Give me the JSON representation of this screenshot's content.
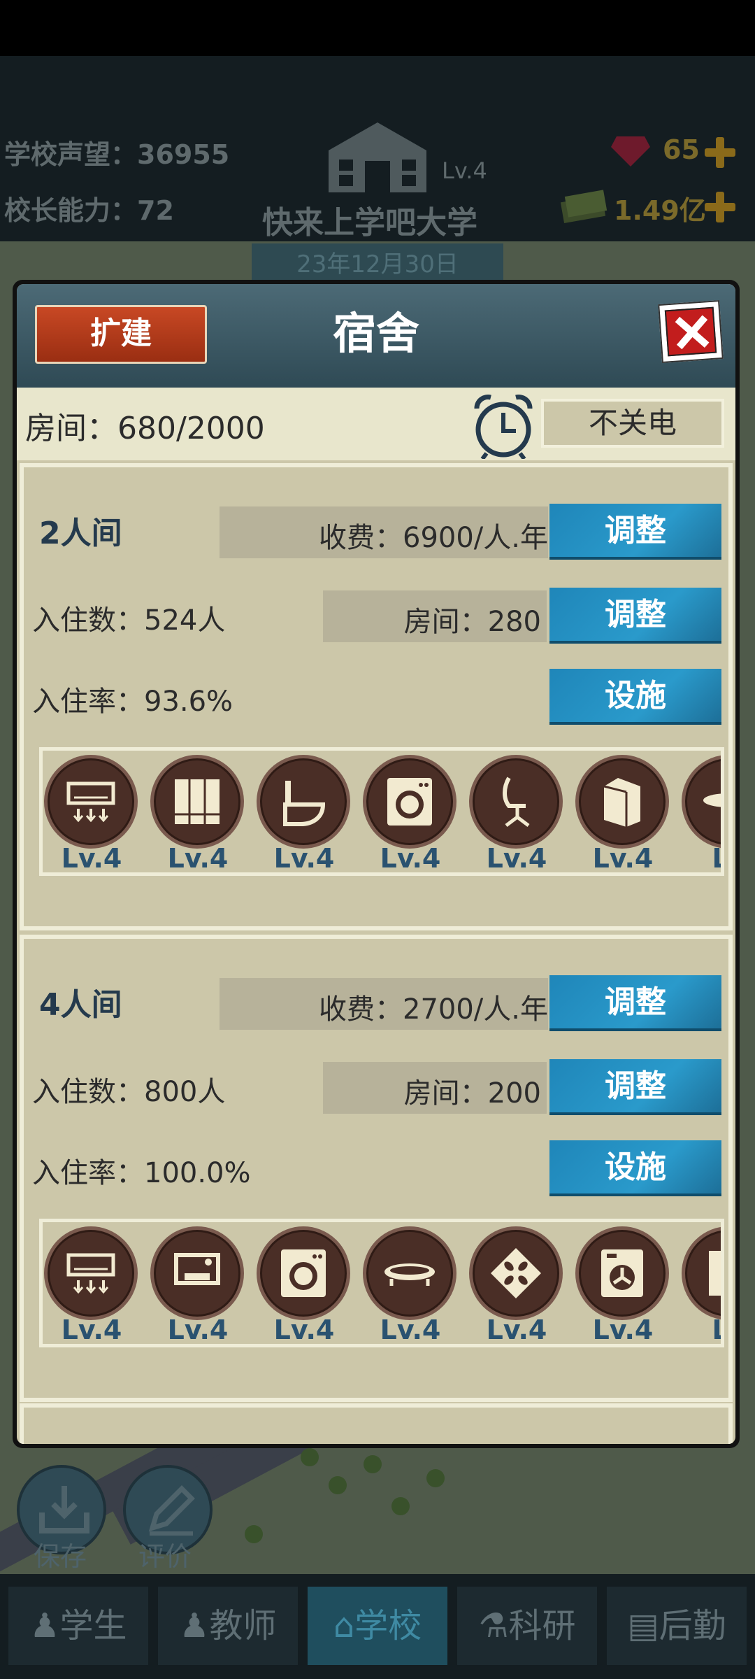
{
  "top_bar": {
    "reputation": "学校声望：36955",
    "principal_ability": "校长能力：72",
    "school_level": "Lv.4",
    "school_name": "快来上学吧大学",
    "gems": "65",
    "money": "1.49亿",
    "date": "23年12月30日"
  },
  "modal": {
    "title": "宿舍",
    "expand_label": "扩建",
    "rooms": "房间：680/2000",
    "power_label": "不关电",
    "sections": [
      {
        "label": "2人间",
        "fee": "收费：6900/人.年",
        "occupants": "入住数：524人",
        "rooms": "房间：280",
        "rate": "入住率：93.6%",
        "adjust_label": "调整",
        "facility_label": "设施",
        "facilities": [
          {
            "icon": "air-conditioner-icon",
            "level": "Lv.4"
          },
          {
            "icon": "wardrobe-icon",
            "level": "Lv.4"
          },
          {
            "icon": "toilet-icon",
            "level": "Lv.4"
          },
          {
            "icon": "washing-machine-icon",
            "level": "Lv.4"
          },
          {
            "icon": "chair-icon",
            "level": "Lv.4"
          },
          {
            "icon": "water-heater-icon",
            "level": "Lv.4"
          },
          {
            "icon": "bed-icon",
            "level": "Lv"
          }
        ]
      },
      {
        "label": "4人间",
        "fee": "收费：2700/人.年",
        "occupants": "入住数：800人",
        "rooms": "房间：200",
        "rate": "入住率：100.0%",
        "adjust_label": "调整",
        "facility_label": "设施",
        "facilities": [
          {
            "icon": "air-conditioner-icon",
            "level": "Lv.4"
          },
          {
            "icon": "sink-icon",
            "level": "Lv.4"
          },
          {
            "icon": "washing-machine-icon",
            "level": "Lv.4"
          },
          {
            "icon": "bed-icon",
            "level": "Lv.4"
          },
          {
            "icon": "ceiling-fan-icon",
            "level": "Lv.4"
          },
          {
            "icon": "dryer-icon",
            "level": "Lv.4"
          },
          {
            "icon": "appliance-icon",
            "level": "Lv"
          }
        ]
      }
    ]
  },
  "side_buttons": {
    "save": "保存",
    "review": "评价"
  },
  "bottom_nav": [
    {
      "label": "学生",
      "icon": "student-icon"
    },
    {
      "label": "教师",
      "icon": "teacher-icon"
    },
    {
      "label": "学校",
      "icon": "school-icon"
    },
    {
      "label": "科研",
      "icon": "flask-icon"
    },
    {
      "label": "后勤",
      "icon": "clipboard-icon"
    }
  ],
  "colors": {
    "accent": "#2a9acb",
    "danger": "#c21d1d",
    "panel": "#ccc7a9"
  }
}
